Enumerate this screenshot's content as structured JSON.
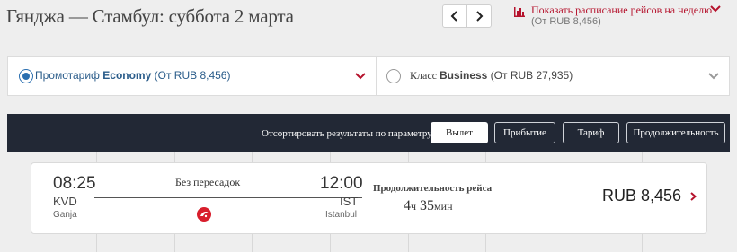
{
  "header": {
    "title": "Гянджа — Стамбул: суббота 2 марта",
    "schedule_link": "Показать расписание рейсов на неделю",
    "schedule_sub": "(От RUB 8,456)"
  },
  "fares": {
    "economy": {
      "prefix": "Промотариф ",
      "cabin": "Economy",
      "price": " (От RUB 8,456)"
    },
    "business": {
      "prefix": "Класс ",
      "cabin": "Business",
      "price": " (От RUB 27,935)"
    }
  },
  "sort": {
    "label": "Отсортировать результаты по параметру",
    "buttons": [
      "Вылет",
      "Прибытие",
      "Тариф",
      "Продолжительность"
    ],
    "active_index": 0
  },
  "flight": {
    "depart_time": "08:25",
    "depart_code": "KVD",
    "depart_city": "Ganja",
    "stops": "Без пересадок",
    "arrive_time": "12:00",
    "arrive_code": "IST",
    "arrive_city": "Istanbul",
    "airline_icon": "turkish-airlines-logo",
    "duration_label": "Продолжительность рейса",
    "duration_hours": "4",
    "duration_h_unit": "ч",
    "duration_minutes": "35",
    "duration_m_unit": "мин",
    "price": "RUB 8,456"
  },
  "colors": {
    "accent_red": "#b5122c",
    "link_blue": "#2a5c8a",
    "sort_bar": "#222835"
  }
}
